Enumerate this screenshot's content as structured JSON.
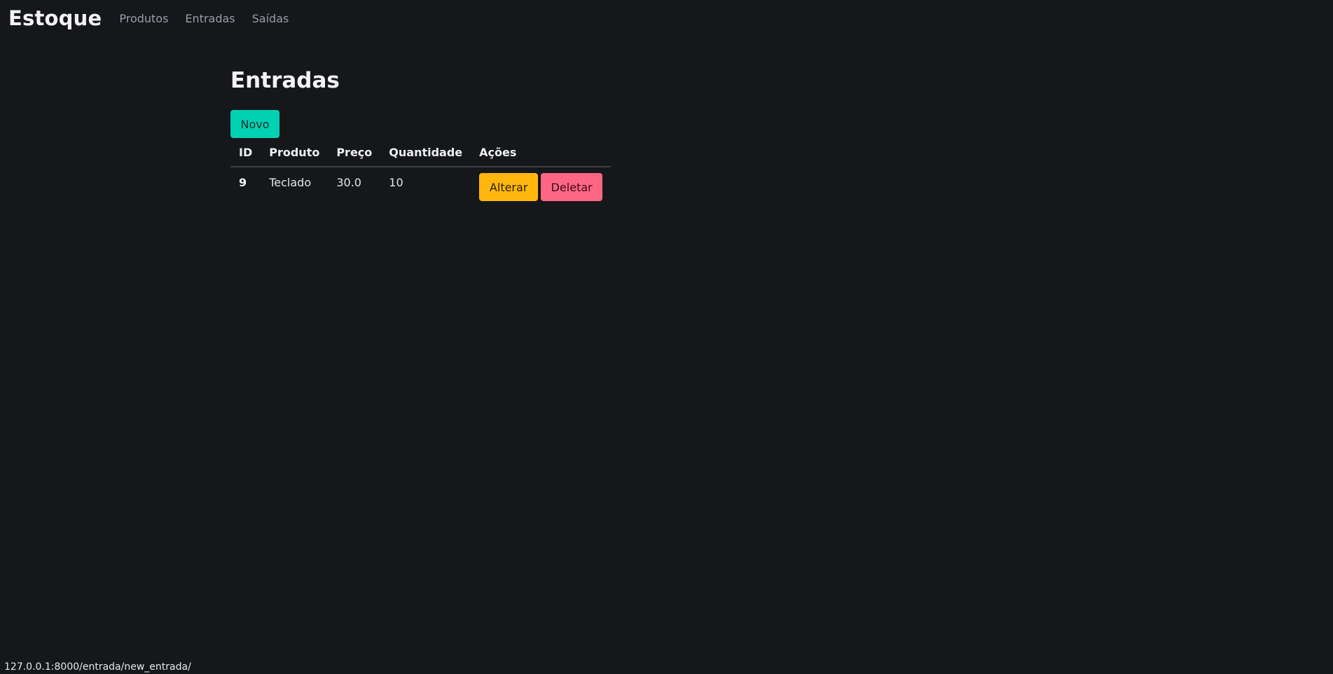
{
  "navbar": {
    "brand": "Estoque",
    "links": [
      "Produtos",
      "Entradas",
      "Saídas"
    ]
  },
  "main": {
    "title": "Entradas",
    "new_button": "Novo",
    "table": {
      "headers": [
        "ID",
        "Produto",
        "Preço",
        "Quantidade",
        "Ações"
      ],
      "rows": [
        {
          "id": "9",
          "produto": "Teclado",
          "preco": "30.0",
          "quantidade": "10",
          "actions": {
            "edit": "Alterar",
            "delete": "Deletar"
          }
        }
      ]
    }
  },
  "status_bar": {
    "url": "127.0.0.1:8000/entrada/new_entrada/"
  },
  "colors": {
    "background": "#15171b",
    "primary": "#00d1b2",
    "warning": "#ffb70f",
    "danger": "#ff6685"
  }
}
